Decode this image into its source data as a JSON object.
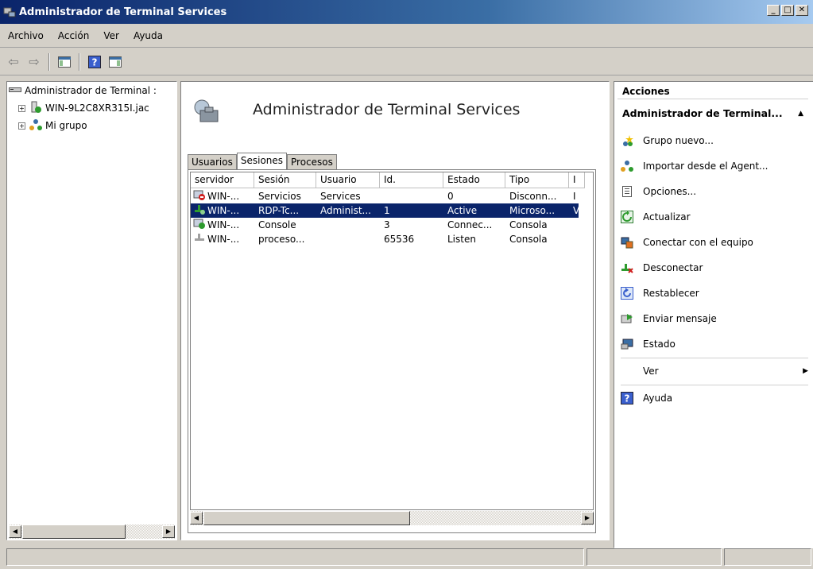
{
  "window": {
    "title": "Administrador de Terminal Services"
  },
  "menu": [
    "Archivo",
    "Acción",
    "Ver",
    "Ayuda"
  ],
  "tree": {
    "root_label": "Administrador de Terminal :",
    "items": [
      "WIN-9L2C8XR315I.jac",
      "Mi grupo"
    ]
  },
  "center": {
    "heading": "Administrador de Terminal Services",
    "tabs": [
      "Usuarios",
      "Sesiones",
      "Procesos"
    ],
    "active_tab": "Sesiones",
    "columns": [
      "servidor",
      "Sesión",
      "Usuario",
      "Id.",
      "Estado",
      "Tipo",
      "I"
    ],
    "rows": [
      [
        "WIN-...",
        "Servicios",
        "Services",
        "",
        "0",
        "Disconn...",
        "I"
      ],
      [
        "WIN-...",
        "RDP-Tc...",
        "Administ...",
        "1",
        "Active",
        "Microso...",
        "V"
      ],
      [
        "WIN-...",
        "Console",
        "",
        "3",
        "Connec...",
        "Consola",
        ""
      ],
      [
        "WIN-...",
        "proceso...",
        "",
        "65536",
        "Listen",
        "Consola",
        ""
      ]
    ],
    "selected_row": 1
  },
  "actions": {
    "title": "Acciones",
    "section": "Administrador de Terminal...",
    "items": [
      "Grupo nuevo...",
      "Importar desde el Agent...",
      "Opciones...",
      "Actualizar",
      "Conectar con el equipo",
      "Desconectar",
      "Restablecer",
      "Enviar mensaje",
      "Estado",
      "Ver",
      "Ayuda"
    ]
  },
  "colors": {
    "title_start": "#0a246a",
    "title_end": "#a6caf0",
    "selection": "#0a246a",
    "face": "#d4d0c8"
  }
}
